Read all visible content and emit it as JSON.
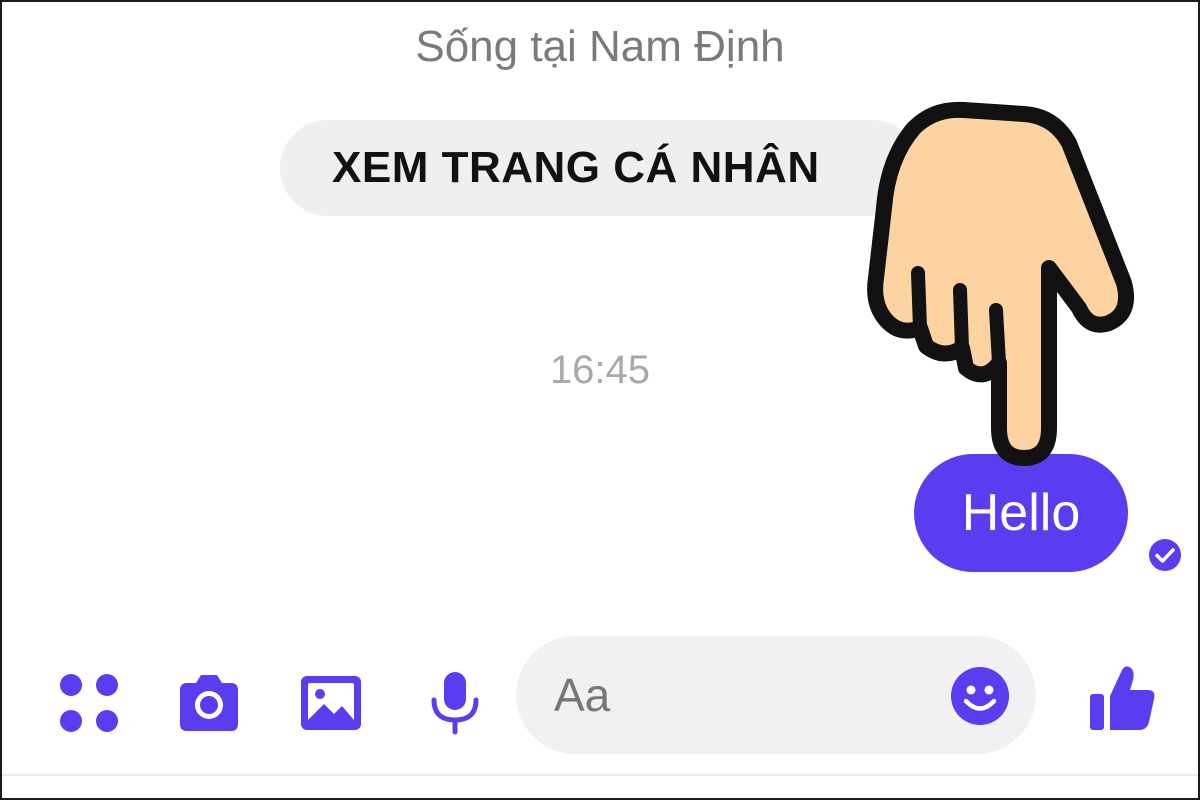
{
  "profile": {
    "lives_in": "Sống tại Nam Định",
    "view_profile_label": "XEM TRANG CÁ NHÂN"
  },
  "conversation": {
    "timestamp": "16:45",
    "messages": [
      {
        "text": "Hello",
        "status": "sent"
      }
    ]
  },
  "composer": {
    "placeholder": "Aa",
    "icons": [
      "apps-icon",
      "camera-icon",
      "image-icon",
      "microphone-icon",
      "emoji-icon",
      "like-icon"
    ]
  },
  "colors": {
    "accent": "#5b3cf0",
    "bubble_text": "#ffffff",
    "input_bg": "#f1f1f3",
    "hand_fill": "#fcd3a1"
  }
}
